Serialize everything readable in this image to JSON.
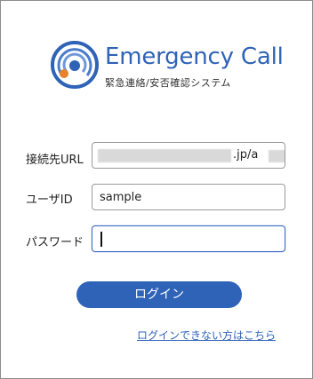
{
  "brand": {
    "title": "Emergency Call",
    "subtitle": "緊急連絡/安否確認システム",
    "icon": "emergency-call-logo",
    "colors": {
      "primary": "#2e63b8",
      "accent": "#e8822a"
    }
  },
  "form": {
    "url": {
      "label": "接続先URL",
      "visible_value": ".jp/a"
    },
    "user_id": {
      "label": "ユーザID",
      "value": "sample"
    },
    "password": {
      "label": "パスワード",
      "value": ""
    }
  },
  "actions": {
    "login_label": "ログイン",
    "help_link_label": "ログインできない方はこちら"
  }
}
